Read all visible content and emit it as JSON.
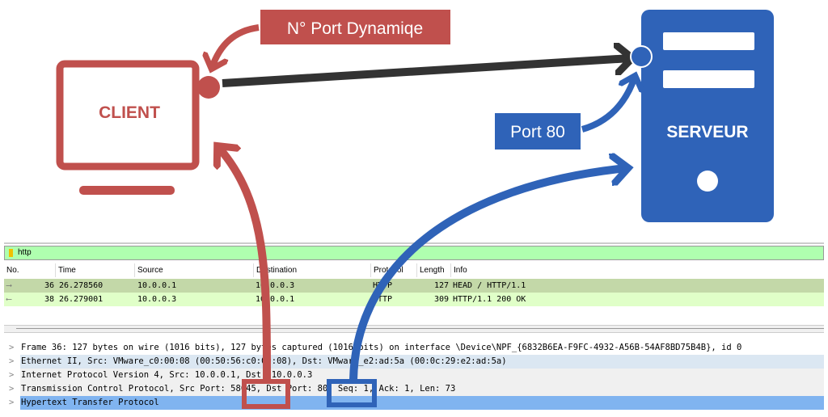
{
  "diagram": {
    "client_label": "CLIENT",
    "server_label": "SERVEUR",
    "dynamic_port_label": "N° Port Dynamiqe",
    "port80_label": "Port 80",
    "colors": {
      "client": "#c0504d",
      "server": "#2f63b8",
      "connection": "#333333"
    }
  },
  "wireshark": {
    "filter": "http",
    "columns": [
      "No.",
      "Time",
      "Source",
      "Destination",
      "Protocol",
      "Length",
      "Info"
    ],
    "packets": [
      {
        "no": "36",
        "time": "26.278560",
        "source": "10.0.0.1",
        "destination": "10.0.0.3",
        "protocol": "HTTP",
        "length": "127",
        "info": "HEAD / HTTP/1.1"
      },
      {
        "no": "38",
        "time": "26.279001",
        "source": "10.0.0.3",
        "destination": "10.0.0.1",
        "protocol": "HTTP",
        "length": "309",
        "info": "HTTP/1.1 200 OK"
      }
    ],
    "details": [
      "Frame 36: 127 bytes on wire (1016 bits), 127 bytes captured (1016 bits) on interface \\Device\\NPF_{6832B6EA-F9FC-4932-A56B-54AF8BD75B4B}, id 0",
      "Ethernet II, Src: VMware_c0:00:08 (00:50:56:c0:00:08), Dst: VMware_e2:ad:5a (00:0c:29:e2:ad:5a)",
      "Internet Protocol Version 4, Src: 10.0.0.1, Dst: 10.0.0.3",
      "Transmission Control Protocol, Src Port: 58045, Dst Port: 80, Seq: 1, Ack: 1, Len: 73",
      "Hypertext Transfer Protocol"
    ],
    "src_port": "58045",
    "dst_port": "80"
  }
}
